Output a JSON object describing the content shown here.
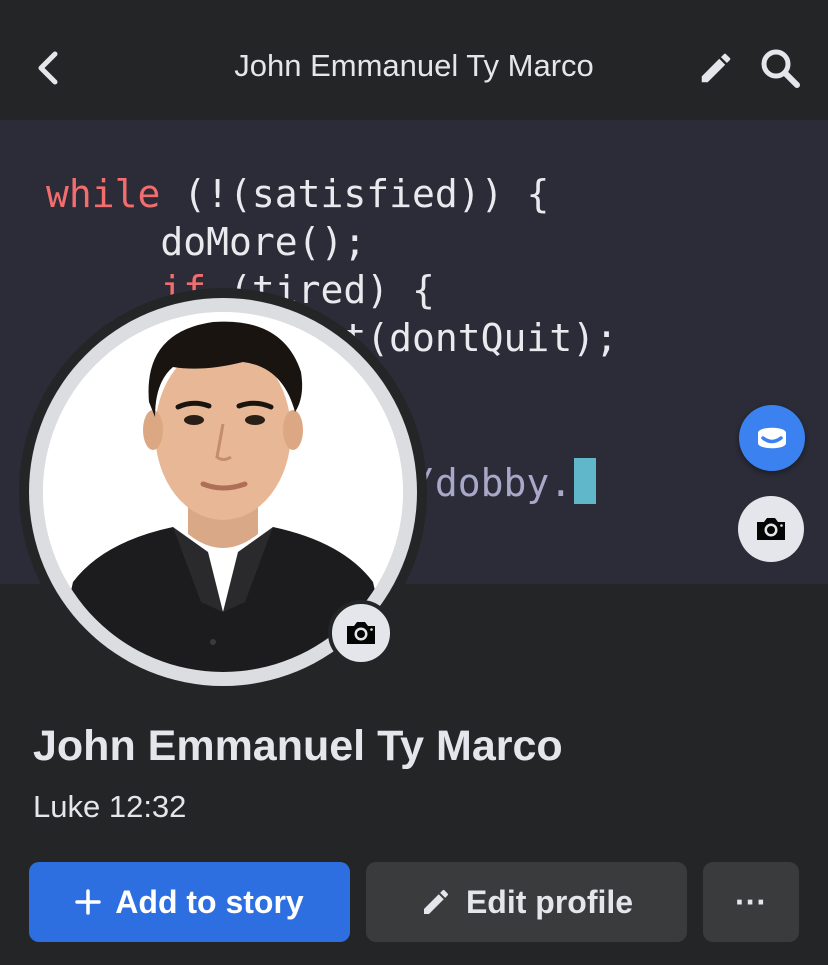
{
  "header": {
    "title": "John Emmanuel Ty Marco",
    "back_icon": "chevron-left-icon",
    "edit_icon": "pencil-icon",
    "search_icon": "search-icon"
  },
  "cover": {
    "code_lines": {
      "l1_kw": "while",
      "l1_rest": " (!(satisfied)) {",
      "l2": "     doMore();",
      "l3_kw": "     if",
      "l3_rest": " (tired) {",
      "l4": "          rest(dontQuit);",
      "l5": "",
      "l6": "",
      "l7": "               //dobby."
    }
  },
  "profile": {
    "name": "John Emmanuel Ty Marco",
    "bio": "Luke 12:32"
  },
  "actions": {
    "add_story_label": "Add to story",
    "edit_profile_label": "Edit profile",
    "more_label": "···"
  },
  "colors": {
    "background": "#242526",
    "primary_button": "#2d6fe0",
    "secondary_button": "#3a3b3c",
    "messenger_badge": "#3b82f0"
  }
}
